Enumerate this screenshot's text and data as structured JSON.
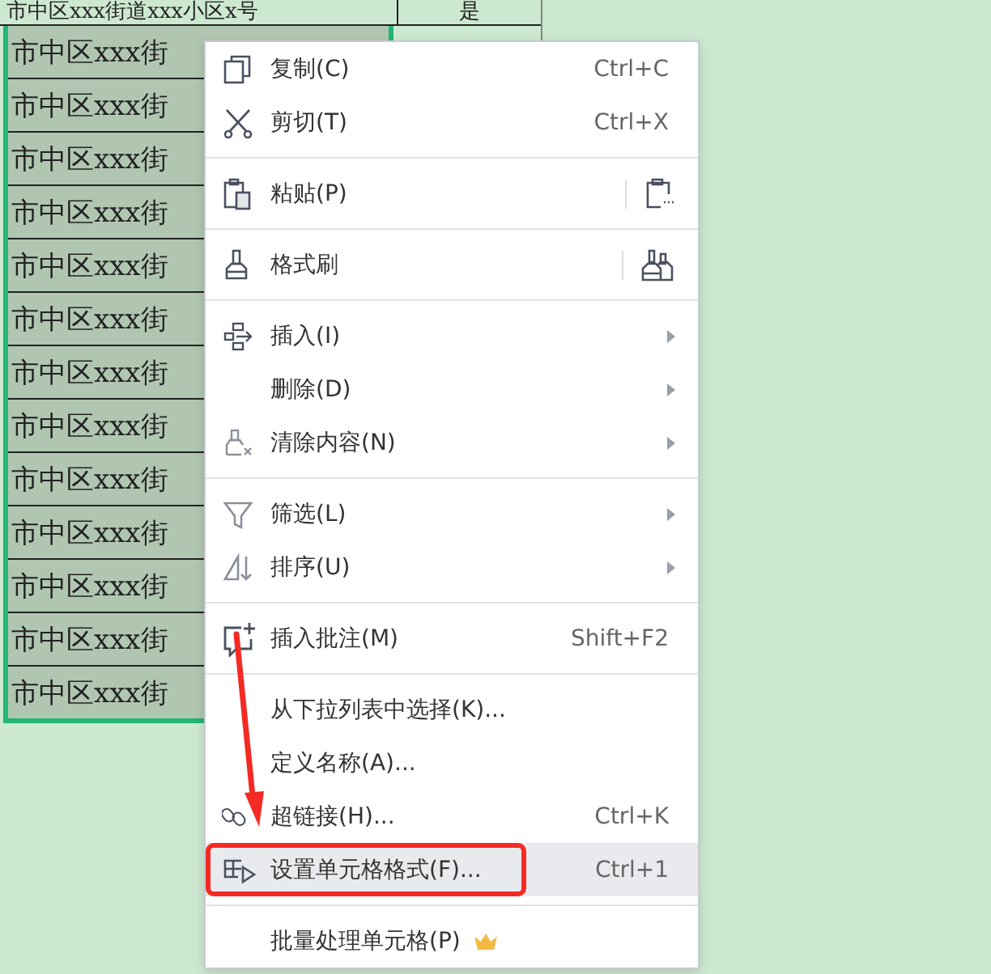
{
  "sheet": {
    "top_row": {
      "col_a": "市中区xxx街道xxx小区x号",
      "col_b": "是"
    },
    "rows": [
      "市中区xxx街",
      "市中区xxx街",
      "市中区xxx街",
      "市中区xxx街",
      "市中区xxx街",
      "市中区xxx街",
      "市中区xxx街",
      "市中区xxx街",
      "市中区xxx街",
      "市中区xxx街",
      "市中区xxx街",
      "市中区xxx街",
      "市中区xxx街"
    ]
  },
  "context_menu": {
    "items": [
      {
        "kind": "item",
        "label": "复制(C)",
        "shortcut": "Ctrl+C",
        "submenu": false,
        "selected": false
      },
      {
        "kind": "item",
        "label": "剪切(T)",
        "shortcut": "Ctrl+X",
        "submenu": false,
        "selected": false
      },
      {
        "kind": "separator"
      },
      {
        "kind": "item",
        "label": "粘贴(P)",
        "submenu": false,
        "selected": false,
        "side_button": true
      },
      {
        "kind": "separator"
      },
      {
        "kind": "item",
        "label": "格式刷",
        "submenu": false,
        "selected": false,
        "side_button": true
      },
      {
        "kind": "separator"
      },
      {
        "kind": "item",
        "label": "插入(I)",
        "submenu": true,
        "selected": false
      },
      {
        "kind": "item",
        "label": "删除(D)",
        "submenu": true,
        "selected": false
      },
      {
        "kind": "item",
        "label": "清除内容(N)",
        "submenu": true,
        "selected": false
      },
      {
        "kind": "separator"
      },
      {
        "kind": "item",
        "label": "筛选(L)",
        "submenu": true,
        "selected": false
      },
      {
        "kind": "item",
        "label": "排序(U)",
        "submenu": true,
        "selected": false
      },
      {
        "kind": "separator"
      },
      {
        "kind": "item",
        "label": "插入批注(M)",
        "shortcut": "Shift+F2",
        "submenu": false,
        "selected": false
      },
      {
        "kind": "separator"
      },
      {
        "kind": "item",
        "label": "从下拉列表中选择(K)...",
        "submenu": false,
        "selected": false
      },
      {
        "kind": "item",
        "label": "定义名称(A)...",
        "submenu": false,
        "selected": false
      },
      {
        "kind": "item",
        "label": "超链接(H)...",
        "shortcut": "Ctrl+K",
        "submenu": false,
        "selected": false
      },
      {
        "kind": "item",
        "label": "设置单元格格式(F)...",
        "shortcut": "Ctrl+1",
        "submenu": false,
        "selected": true,
        "annotated": true
      },
      {
        "kind": "separator"
      },
      {
        "kind": "item",
        "label": "批量处理单元格(P)",
        "submenu": false,
        "selected": false,
        "premium": true
      }
    ]
  }
}
